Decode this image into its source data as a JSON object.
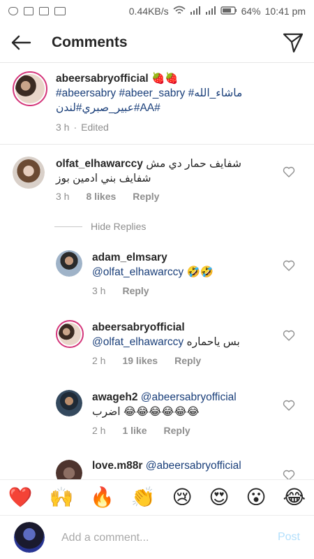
{
  "status_bar": {
    "speed": "0.44KB/s",
    "battery": "64%",
    "time": "10:41 pm"
  },
  "header": {
    "title": "Comments"
  },
  "caption": {
    "username": "abeersabryofficial",
    "emoji": "🍓🍓",
    "line1": "#abeersabry #abeer_sabry #ماشاء_الله",
    "line2": "عبير_صبري#لندن#AA#",
    "time": "3 h",
    "edited": "Edited"
  },
  "comments": [
    {
      "username": "olfat_elhawarccy",
      "text": "شفايف حمار دي مش",
      "text2": "شفايف بني ادمين بوز",
      "time": "3 h",
      "likes": "8 likes",
      "reply": "Reply"
    }
  ],
  "hide_replies": "Hide Replies",
  "replies": [
    {
      "username": "adam_elmsary",
      "mention": "@olfat_elhawarccy",
      "text": "🤣🤣",
      "time": "3 h",
      "likes": "",
      "reply": "Reply"
    },
    {
      "username": "abeersabryofficial",
      "mention": "@olfat_elhawarccy",
      "text": "بس ياحماره",
      "time": "2 h",
      "likes": "19 likes",
      "reply": "Reply"
    },
    {
      "username": "awageh2",
      "mention": "@abeersabryofficial",
      "text": "اضرب 😂😂😂😂😂😂",
      "time": "2 h",
      "likes": "1 like",
      "reply": "Reply"
    },
    {
      "username": "love.m88r",
      "mention": "@abeersabryofficial",
      "text": "",
      "time": "",
      "likes": "",
      "reply": ""
    }
  ],
  "emoji_bar": [
    "❤️",
    "🙌",
    "🔥",
    "👏",
    "😢",
    "😍",
    "😮",
    "😂"
  ],
  "comment_input": {
    "placeholder": "Add a comment...",
    "post_label": "Post"
  }
}
